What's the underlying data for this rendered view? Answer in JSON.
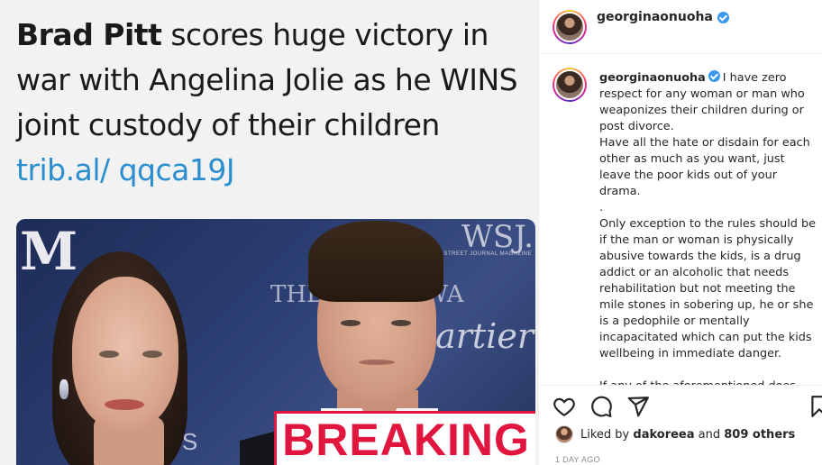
{
  "post_image": {
    "headline_bold": "Brad Pitt",
    "headline_rest": " scores huge victory in war with Angelina Jolie as he WINS joint custody of their children ",
    "headline_link": "trib.al/ qqca19J",
    "photo": {
      "logo_m": "M",
      "backdrop_wsj": "WSJ.",
      "backdrop_wsj_sub": "THE WALL STREET JOURNAL MAGAZINE",
      "backdrop_inno": "THE INNO AWA",
      "backdrop_cartier": "Cartier",
      "backdrop_nts": "N",
      "backdrop_ts": "TS",
      "banner": "BREAKING"
    }
  },
  "header": {
    "username": "georginaonuoha",
    "verified": true
  },
  "caption": {
    "username": "georginaonuoha",
    "verified": true,
    "text": "I have zero respect for any woman or man who weaponizes their children during or post divorce.\nHave all the hate or disdain for each other as much as you want, just leave the poor kids out of your drama.\n.\nOnly exception to the rules should be if the man or woman is physically abusive towards the kids, is a drug addict or an alcoholic that needs rehabilitation but not meeting the mile stones in sobering up, he or she is a pedophile or mentally incapacitated which can put the kids wellbeing in immediate danger.\n\nIf any of the aforementioned does not"
  },
  "actions": {
    "icons": [
      "heart-icon",
      "comment-icon",
      "share-icon",
      "bookmark-icon"
    ],
    "liked_by_prefix": "Liked by ",
    "liked_by_user": "dakoreea",
    "liked_by_mid": " and ",
    "liked_by_others": "809 others",
    "timestamp": "1 DAY AGO"
  },
  "colors": {
    "link": "#2b8ecf",
    "breaking": "#e0163f",
    "verified": "#3897f0"
  }
}
